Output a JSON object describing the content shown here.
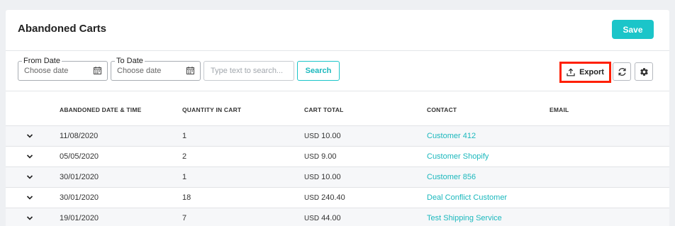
{
  "header": {
    "title": "Abandoned Carts",
    "save_label": "Save"
  },
  "toolbar": {
    "from_date": {
      "label": "From Date",
      "placeholder": "Choose date"
    },
    "to_date": {
      "label": "To Date",
      "placeholder": "Choose date"
    },
    "search": {
      "placeholder": "Type text to search...",
      "value": ""
    },
    "search_button": "Search",
    "export_label": "Export",
    "highlight_color": "#ff1f00",
    "accent_color": "#1bc5c9",
    "icons": [
      "calendar-icon",
      "upload-icon",
      "refresh-icon",
      "gear-icon",
      "chevron-down-icon"
    ]
  },
  "table": {
    "columns": [
      "ABANDONED DATE & TIME",
      "QUANTITY IN CART",
      "CART TOTAL",
      "CONTACT",
      "EMAIL"
    ],
    "rows": [
      {
        "date": "11/08/2020",
        "qty": "1",
        "currency": "USD",
        "total": "10.00",
        "contact": "Customer 412",
        "email": ""
      },
      {
        "date": "05/05/2020",
        "qty": "2",
        "currency": "USD",
        "total": "9.00",
        "contact": "Customer Shopify",
        "email": ""
      },
      {
        "date": "30/01/2020",
        "qty": "1",
        "currency": "USD",
        "total": "10.00",
        "contact": "Customer 856",
        "email": ""
      },
      {
        "date": "30/01/2020",
        "qty": "18",
        "currency": "USD",
        "total": "240.40",
        "contact": "Deal Conflict Customer",
        "email": ""
      },
      {
        "date": "19/01/2020",
        "qty": "7",
        "currency": "USD",
        "total": "44.00",
        "contact": "Test Shipping Service",
        "email": ""
      }
    ]
  }
}
